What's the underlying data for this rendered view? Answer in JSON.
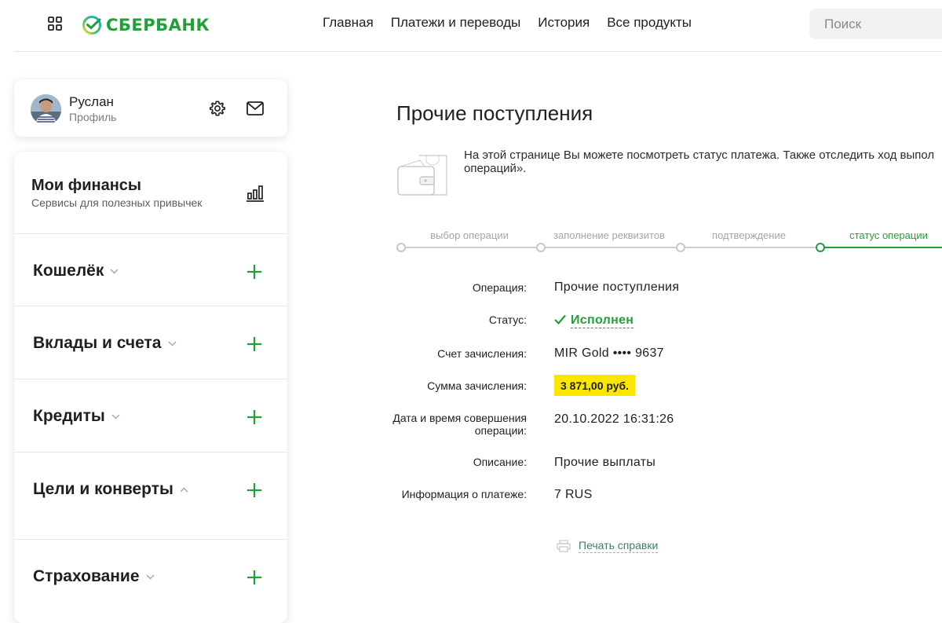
{
  "header": {
    "logo_text": "СБЕРБАНК",
    "nav": [
      "Главная",
      "Платежи и переводы",
      "История",
      "Все продукты"
    ],
    "search_placeholder": "Поиск"
  },
  "profile": {
    "name": "Руслан",
    "subtitle": "Профиль"
  },
  "finances": {
    "title": "Мои финансы",
    "subtitle": "Сервисы для полезных привычек",
    "sections": [
      "Кошелёк",
      "Вклады и счета",
      "Кредиты",
      "Цели и конверты",
      "Страхование"
    ]
  },
  "main": {
    "title": "Прочие поступления",
    "info_line1": "На этой странице Вы можете посмотреть статус платежа. Также отследить ход выпол",
    "info_line2": "операций».",
    "steps": [
      "выбор операции",
      "заполнение реквизитов",
      "подтверждение",
      "статус операции"
    ],
    "active_step": 4,
    "details": [
      {
        "label": "Операция:",
        "value": "Прочие поступления"
      },
      {
        "label": "Статус:",
        "value": "Исполнен"
      },
      {
        "label": "Счет зачисления:",
        "value": "MIR Gold •••• 9637"
      },
      {
        "label": "Сумма зачисления:",
        "value": "3 871,00 руб."
      },
      {
        "label": "Дата и время совершения операции:",
        "value": "20.10.2022 16:31:26"
      },
      {
        "label": "Описание:",
        "value": "Прочие выплаты"
      },
      {
        "label": "Информация о платеже:",
        "value": "7 RUS"
      }
    ],
    "print_label": "Печать справки"
  },
  "colors": {
    "brand_green": "#21a038",
    "highlight_yellow": "#fbe600"
  }
}
